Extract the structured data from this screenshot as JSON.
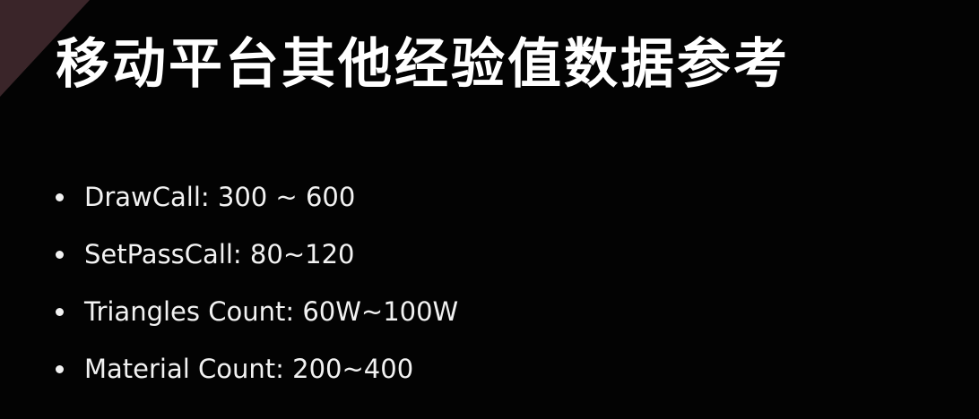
{
  "slide": {
    "title": "移动平台其他经验值数据参考",
    "bullets": [
      {
        "text": "DrawCall: 300 ~ 600"
      },
      {
        "text": "SetPassCall: 80~120"
      },
      {
        "text": "Triangles Count: 60W~100W"
      },
      {
        "text": "Material Count: 200~400"
      }
    ]
  },
  "colors": {
    "background": "#030303",
    "corner_accent": "#3a2529",
    "text": "#ffffff"
  }
}
